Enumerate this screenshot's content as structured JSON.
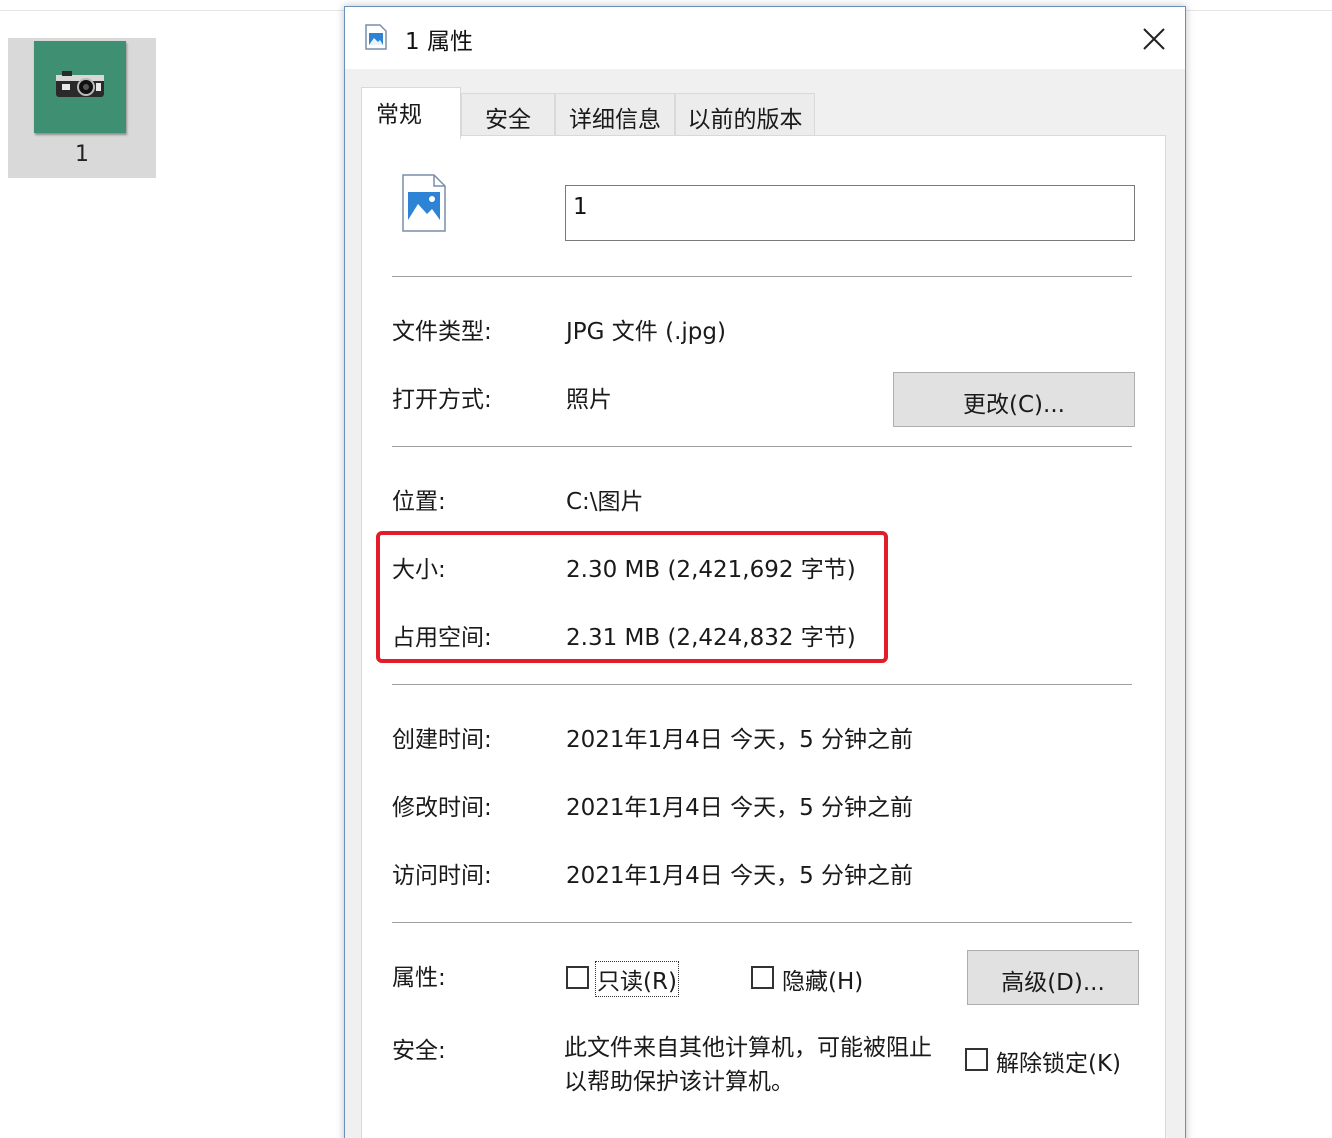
{
  "explorer": {
    "file_label": "1"
  },
  "dialog": {
    "title": "1 属性",
    "tabs": [
      "常规",
      "安全",
      "详细信息",
      "以前的版本"
    ],
    "file_name_value": "1",
    "rows": {
      "type_label": "文件类型:",
      "type_value": "JPG 文件 (.jpg)",
      "open_label": "打开方式:",
      "open_value": "照片",
      "change_button": "更改(C)...",
      "location_label": "位置:",
      "location_value": "C:\\图片",
      "size_label": "大小:",
      "size_value": "2.30 MB (2,421,692 字节)",
      "disk_label": "占用空间:",
      "disk_value": "2.31 MB (2,424,832 字节)",
      "created_label": "创建时间:",
      "created_value": "2021年1月4日 今天，5 分钟之前",
      "modified_label": "修改时间:",
      "modified_value": "2021年1月4日 今天，5 分钟之前",
      "accessed_label": "访问时间:",
      "accessed_value": "2021年1月4日 今天，5 分钟之前",
      "attributes_label": "属性:",
      "readonly_label": "只读(R)",
      "hidden_label": "隐藏(H)",
      "advanced_button": "高级(D)...",
      "security_label": "安全:",
      "security_text_1": "此文件来自其他计算机，可能被阻止",
      "security_text_2": "以帮助保护该计算机。",
      "unblock_label": "解除锁定(K)"
    },
    "checkboxes": {
      "readonly": false,
      "hidden": false,
      "unblock": false
    },
    "highlight_color": "#e01e2a"
  }
}
